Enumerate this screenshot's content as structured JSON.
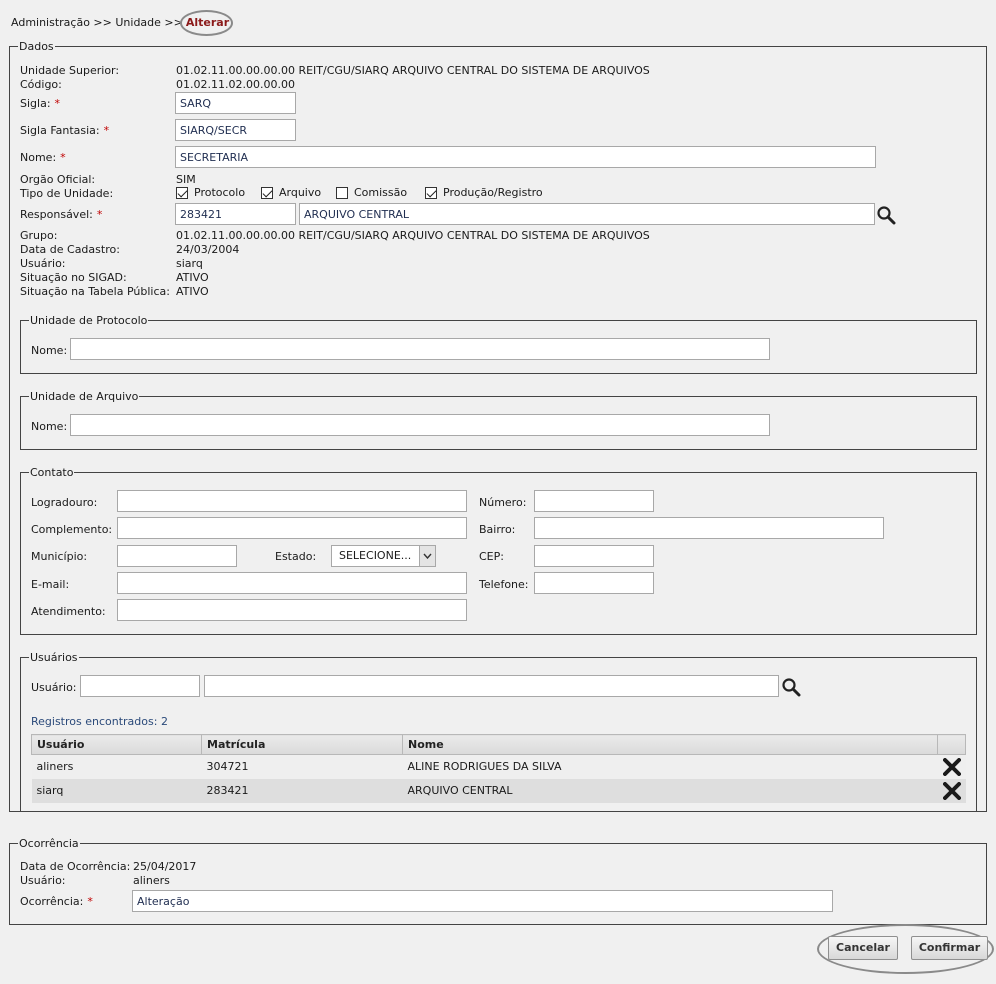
{
  "breadcrumb": {
    "path": "Administração >> Unidade >>",
    "current": "Alterar"
  },
  "dados": {
    "legend": "Dados",
    "unidade_superior": {
      "label": "Unidade Superior:",
      "value": "01.02.11.00.00.00.00 REIT/CGU/SIARQ ARQUIVO CENTRAL DO SISTEMA DE ARQUIVOS"
    },
    "codigo": {
      "label": "Código:",
      "value": "01.02.11.02.00.00.00"
    },
    "sigla": {
      "label": "Sigla:",
      "required": "*",
      "value": "SARQ"
    },
    "sigla_fantasia": {
      "label": "Sigla Fantasia:",
      "required": "*",
      "value": "SIARQ/SECR"
    },
    "nome": {
      "label": "Nome:",
      "required": "*",
      "value": "SECRETARIA"
    },
    "orgao_oficial": {
      "label": "Orgão Oficial:",
      "value": "SIM"
    },
    "tipo_unidade": {
      "label": "Tipo de Unidade:",
      "options": [
        {
          "label": "Protocolo",
          "checked": true
        },
        {
          "label": "Arquivo",
          "checked": true
        },
        {
          "label": "Comissão",
          "checked": false
        },
        {
          "label": "Produção/Registro",
          "checked": true
        }
      ]
    },
    "responsavel": {
      "label": "Responsável:",
      "required": "*",
      "code": "283421",
      "name": "ARQUIVO CENTRAL",
      "search_icon": "search-icon"
    },
    "grupo": {
      "label": "Grupo:",
      "value": "01.02.11.00.00.00.00 REIT/CGU/SIARQ ARQUIVO CENTRAL DO SISTEMA DE ARQUIVOS"
    },
    "data_cadastro": {
      "label": "Data de Cadastro:",
      "value": "24/03/2004"
    },
    "usuario": {
      "label": "Usuário:",
      "value": "siarq"
    },
    "situacao_sigad": {
      "label": "Situação no SIGAD:",
      "value": "ATIVO"
    },
    "situacao_tabela": {
      "label": "Situação na Tabela Pública:",
      "value": "ATIVO"
    }
  },
  "protocolo": {
    "legend": "Unidade de Protocolo",
    "nome_label": "Nome:",
    "nome_value": ""
  },
  "arquivo": {
    "legend": "Unidade de Arquivo",
    "nome_label": "Nome:",
    "nome_value": ""
  },
  "contato": {
    "legend": "Contato",
    "logradouro": "Logradouro:",
    "numero": "Número:",
    "complemento": "Complemento:",
    "bairro": "Bairro:",
    "municipio": "Município:",
    "estado": "Estado:",
    "estado_value": "SELECIONE...",
    "cep": "CEP:",
    "email": "E-mail:",
    "telefone": "Telefone:",
    "atendimento": "Atendimento:"
  },
  "usuarios": {
    "legend": "Usuários",
    "usuario_label": "Usuário:",
    "registros": "Registros encontrados: 2",
    "columns": [
      "Usuário",
      "Matrícula",
      "Nome"
    ],
    "rows": [
      {
        "usuario": "aliners",
        "matricula": "304721",
        "nome": "ALINE RODRIGUES DA SILVA"
      },
      {
        "usuario": "siarq",
        "matricula": "283421",
        "nome": "ARQUIVO CENTRAL"
      }
    ],
    "remove_icon": "close-icon"
  },
  "ocorrencia": {
    "legend": "Ocorrência",
    "data_label": "Data de Ocorrência:",
    "data_value": "25/04/2017",
    "usuario_label": "Usuário:",
    "usuario_value": "aliners",
    "ocorrencia_label": "Ocorrência:",
    "required": "*",
    "ocorrencia_value": "Alteração"
  },
  "actions": {
    "cancel": "Cancelar",
    "confirm": "Confirmar"
  }
}
